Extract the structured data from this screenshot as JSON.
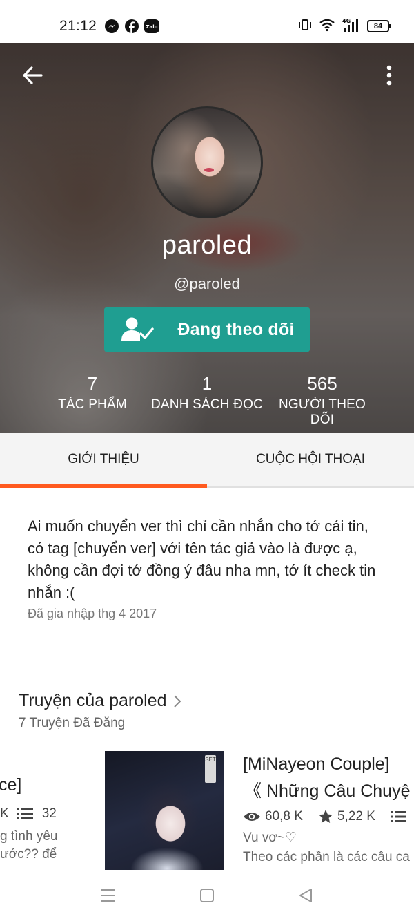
{
  "status_bar": {
    "time": "21:12",
    "battery": "84",
    "apps": [
      "messenger-icon",
      "facebook-icon",
      "zalo-icon"
    ],
    "zalo_label": "Zalo",
    "network": "4G"
  },
  "profile": {
    "display_name": "paroled",
    "username": "@paroled",
    "follow_label": "Đang theo dõi",
    "stats": [
      {
        "value": "7",
        "label": "TÁC PHẨM"
      },
      {
        "value": "1",
        "label": "DANH SÁCH ĐỌC"
      },
      {
        "value": "565",
        "label": "NGƯỜI THEO DÕI"
      }
    ]
  },
  "tabs": [
    {
      "label": "GIỚI THIỆU",
      "active": true
    },
    {
      "label": "CUỘC HỘI THOẠI",
      "active": false
    }
  ],
  "about": {
    "text": "Ai muốn chuyển ver thì chỉ cần nhắn cho tớ cái tin, có tag [chuyển ver] với tên tác giả vào là được ạ, không cần đợi tớ đồng ý đâu nha mn, tớ ít check tin nhắn :(",
    "joined": "Đã gia nhập thg 4 2017"
  },
  "stories": {
    "title": "Truyện của paroled",
    "subtitle": "7 Truyện Đã Đăng",
    "items": [
      {
        "title_fragment": "ce]",
        "meta_left": "K",
        "parts": "32",
        "desc_line1": "g tình yêu",
        "desc_line2": "ước?? để"
      },
      {
        "title_line1": "[MiNayeon Couple]",
        "title_line2": "《 Những Câu Chuyệ",
        "reads": "60,8 K",
        "votes": "5,22 K",
        "tagline": "Vu vơ~♡",
        "desc": "Theo các phần là các câu ca",
        "cover_tag": "SET"
      }
    ]
  },
  "colors": {
    "accent": "#ff5a1f",
    "follow_button": "#1f9e91",
    "tab_bg": "#f4f4f4"
  }
}
